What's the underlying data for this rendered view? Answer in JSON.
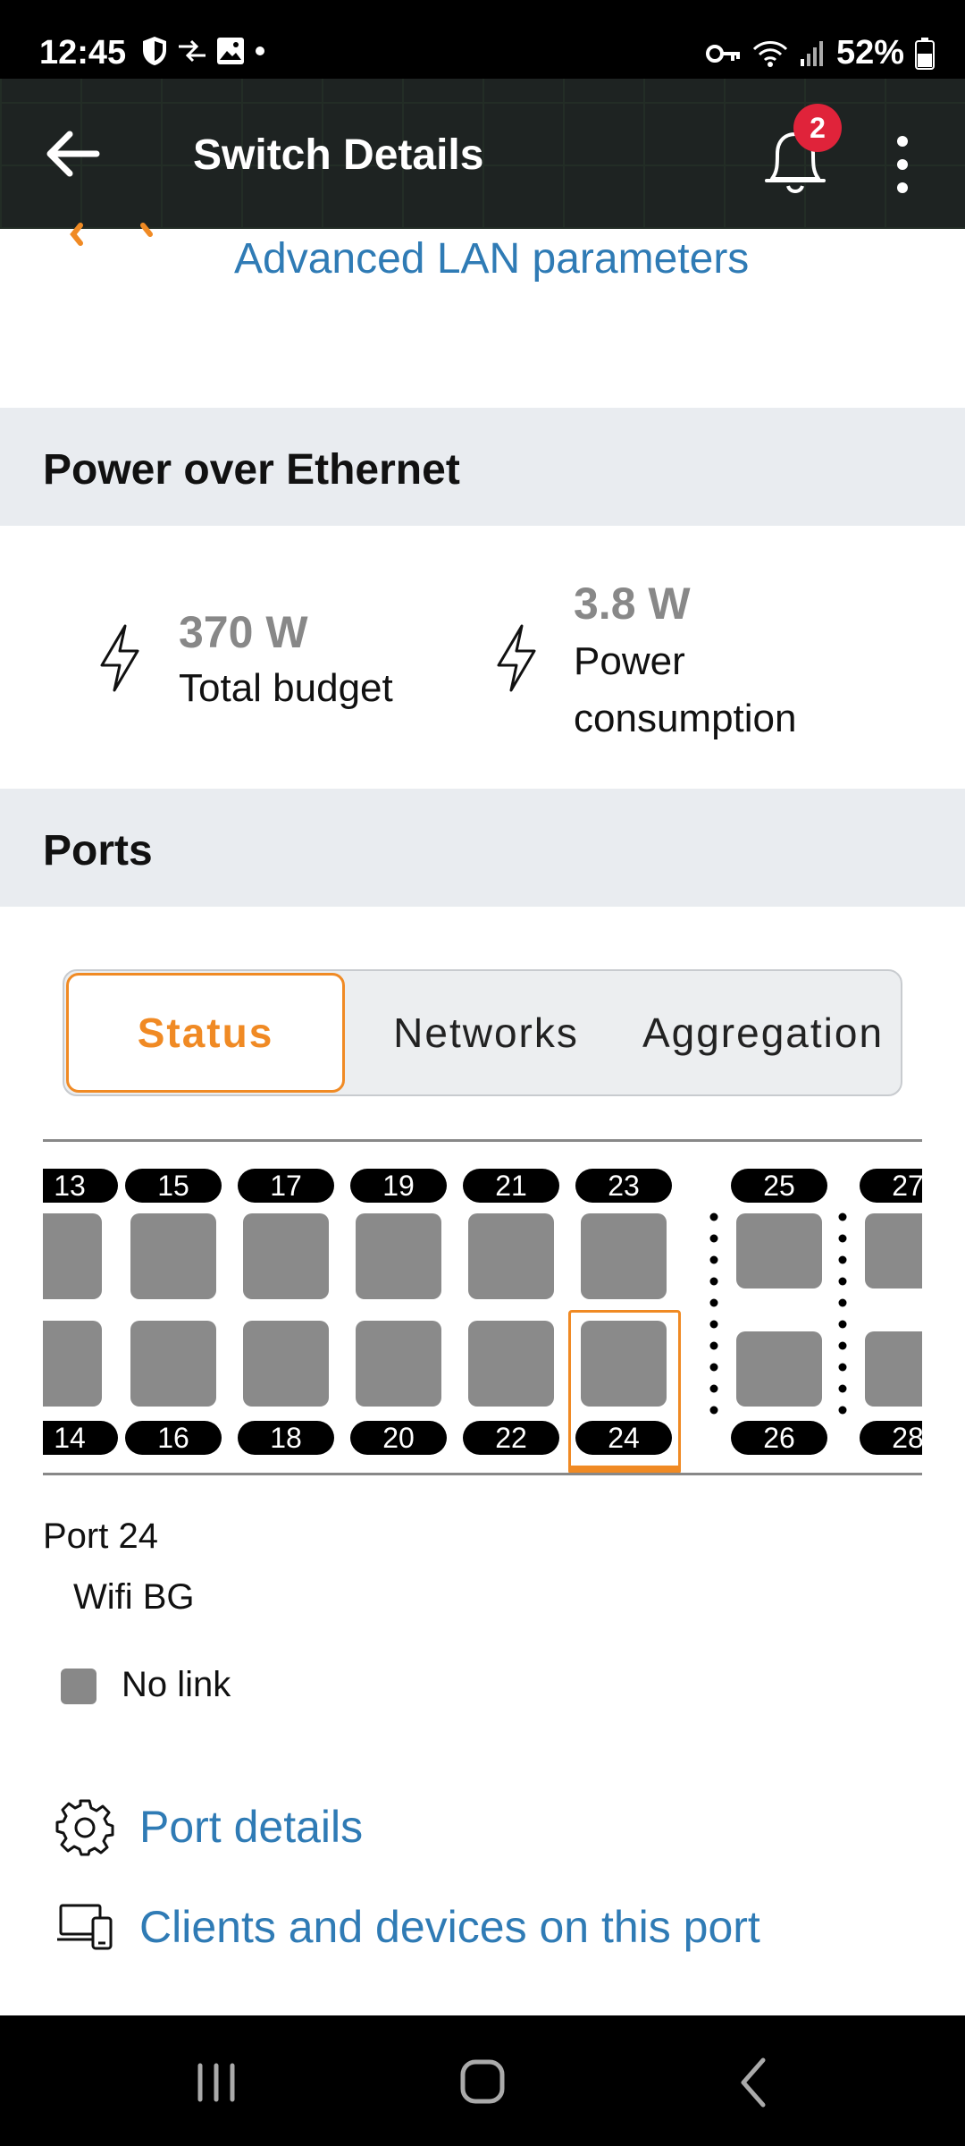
{
  "status_bar": {
    "time": "12:45",
    "battery": "52%"
  },
  "app_bar": {
    "title": "Switch Details",
    "notification_count": "2"
  },
  "advanced_lan_link": "Advanced LAN parameters",
  "poe": {
    "header": "Power over Ethernet",
    "total_budget_value": "370 W",
    "total_budget_label": "Total budget",
    "consumption_value": "3.8 W",
    "consumption_label_line1": "Power",
    "consumption_label_line2": "consumption"
  },
  "ports": {
    "header": "Ports",
    "tabs": [
      "Status",
      "Networks",
      "Aggregation"
    ],
    "active_tab": "Status",
    "top_numbers": [
      "13",
      "15",
      "17",
      "19",
      "21",
      "23",
      "25",
      "27"
    ],
    "bottom_numbers": [
      "14",
      "16",
      "18",
      "20",
      "22",
      "24",
      "26",
      "28"
    ],
    "selected_port": "24"
  },
  "port_info": {
    "title": "Port 24",
    "name": "Wifi BG",
    "link_status": "No link"
  },
  "actions": {
    "port_details": "Port details",
    "clients": "Clients and devices on this port"
  },
  "colors": {
    "accent": "#f08a24",
    "link": "#2f7bb5",
    "port_gray": "#8a8a8a",
    "badge": "#e0233a"
  }
}
